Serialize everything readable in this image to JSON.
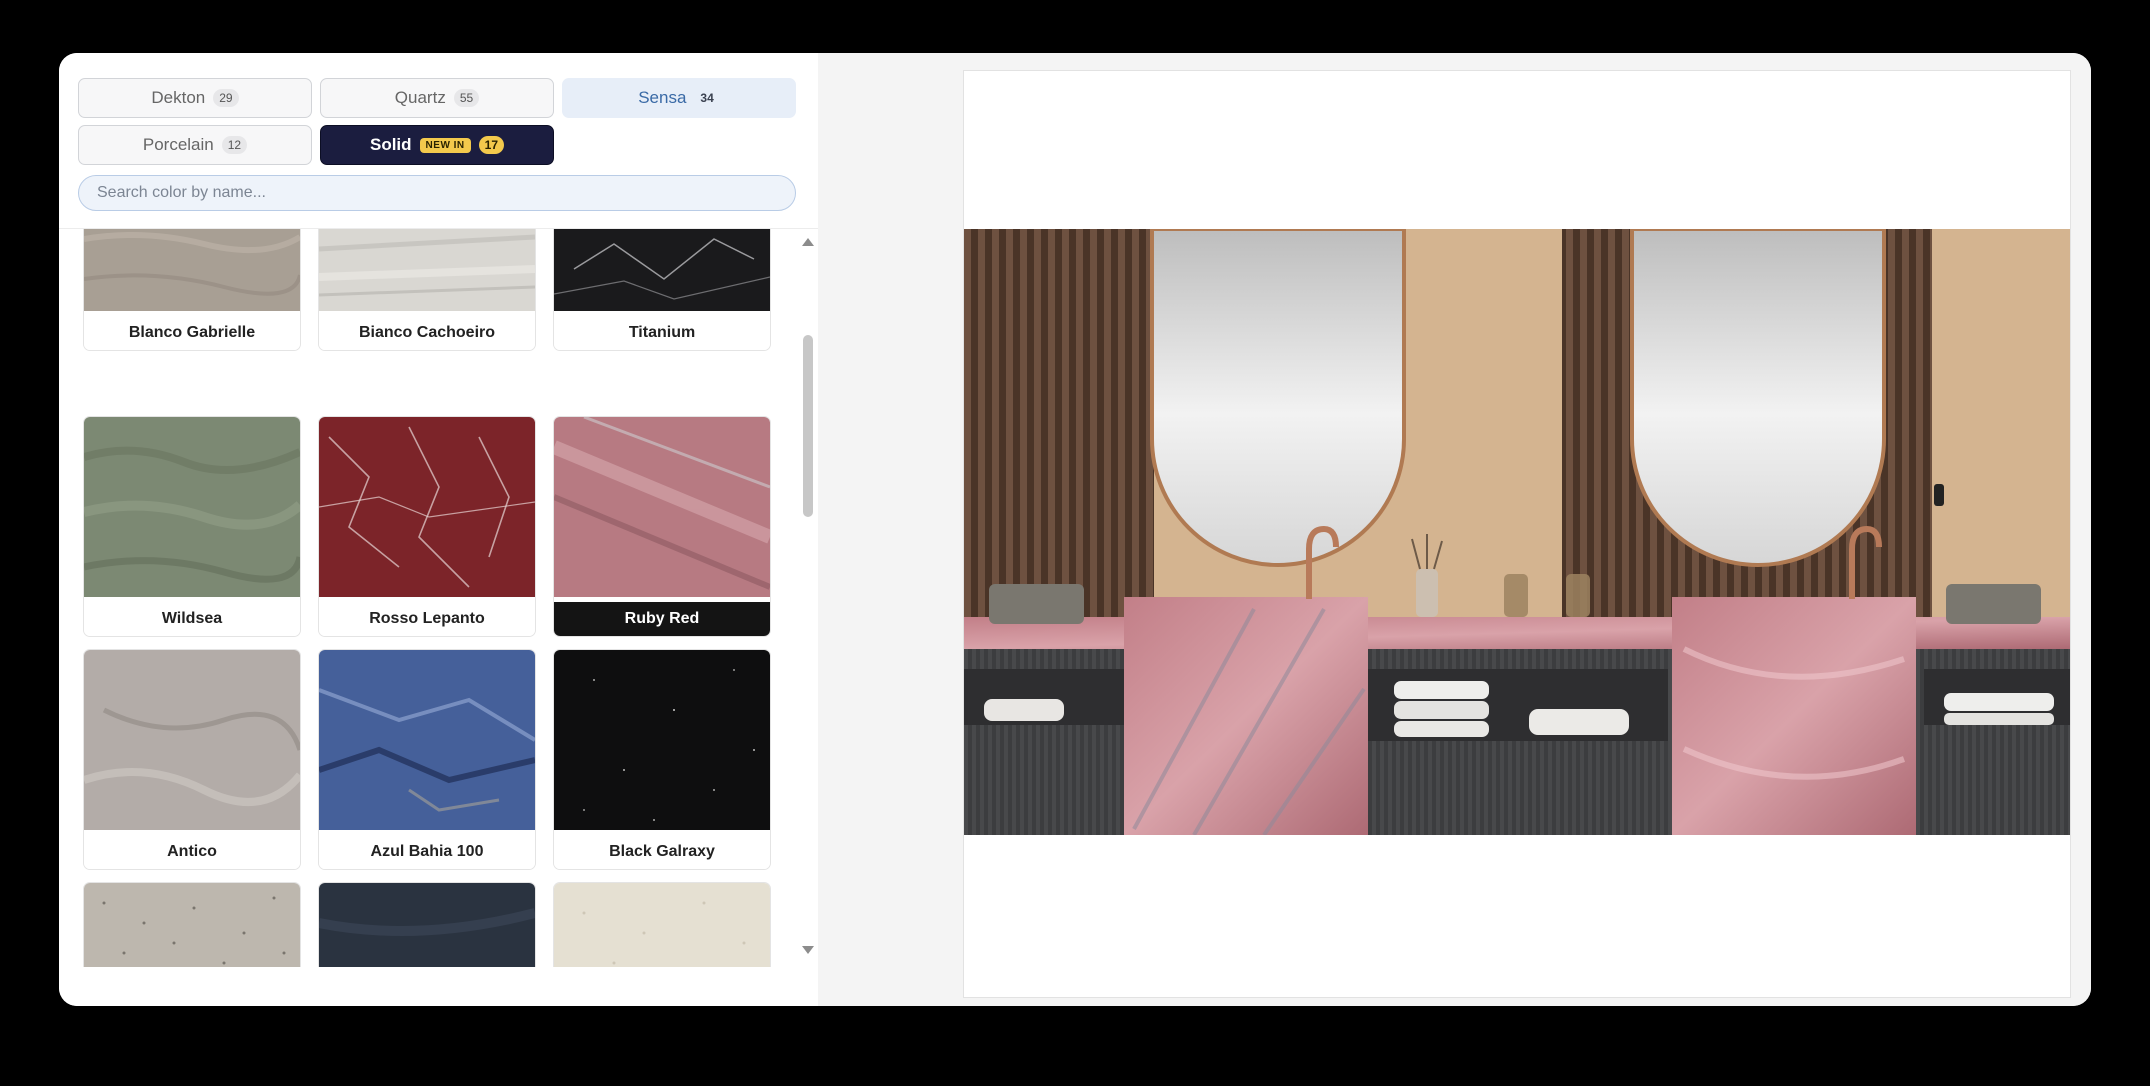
{
  "categories": {
    "dekton": {
      "label": "Dekton",
      "count": "29"
    },
    "quartz": {
      "label": "Quartz",
      "count": "55"
    },
    "sensa": {
      "label": "Sensa",
      "count": "34"
    },
    "porcelain": {
      "label": "Porcelain",
      "count": "12"
    },
    "solid": {
      "label": "Solid",
      "badge": "NEW IN",
      "count": "17"
    }
  },
  "active_category": "Sensa",
  "search": {
    "placeholder": "Search color by name...",
    "value": ""
  },
  "colors": [
    {
      "name": "Blanco Gabrielle",
      "swatch": "#a89f94"
    },
    {
      "name": "Bianco Cachoeiro",
      "swatch": "#d9d7d2"
    },
    {
      "name": "Titanium",
      "swatch": "#1a1a1c"
    },
    {
      "name": "Wildsea",
      "swatch": "#7c8973"
    },
    {
      "name": "Rosso Lepanto",
      "swatch": "#7c2429"
    },
    {
      "name": "Ruby Red",
      "swatch": "#b77a82"
    },
    {
      "name": "Antico",
      "swatch": "#b3aca8"
    },
    {
      "name": "Azul Bahia 100",
      "swatch": "#45609a"
    },
    {
      "name": "Black Galraxy",
      "swatch": "#0e0e0f"
    },
    {
      "name": "",
      "swatch": "#bdb7ae"
    },
    {
      "name": "",
      "swatch": "#2a3340"
    },
    {
      "name": "",
      "swatch": "#e5e0d2"
    }
  ],
  "selected_color": "Ruby Red",
  "preview": {
    "scene": "bathroom vanity preview",
    "accent_surface_color": "#c27f88"
  }
}
